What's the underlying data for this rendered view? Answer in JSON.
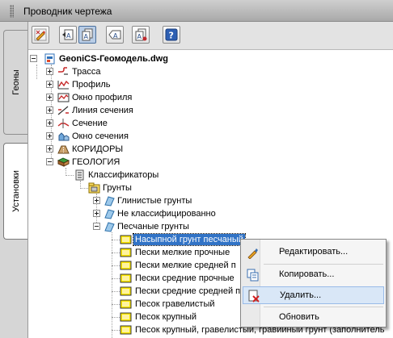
{
  "window": {
    "title": "Проводник чертежа"
  },
  "side_tabs": [
    {
      "label": "Геоны"
    },
    {
      "label": "Установки"
    }
  ],
  "toolbar": {
    "buttons": [
      {
        "icon": "pencil-edit-icon"
      },
      {
        "icon": "doc-a-back-icon"
      },
      {
        "icon": "doc-a-pages-icon",
        "active": true
      },
      {
        "icon": "tag-a-icon"
      },
      {
        "icon": "doc-a-export-icon"
      },
      {
        "icon": "help-icon"
      }
    ]
  },
  "tree": {
    "root": "GeoniCS-Геомодель.dwg",
    "items": {
      "trassa": "Трасса",
      "profil": "Профиль",
      "okno_profilya": "Окно профиля",
      "liniya_secheniya": "Линия сечения",
      "sechenie": "Сечение",
      "okno_secheniya": "Окно сечения",
      "koridory": "КОРИДОРЫ",
      "geologiya": "ГЕОЛОГИЯ",
      "klassifikatory": "Классификаторы",
      "grunty": "Грунты",
      "glinistye": "Глинистые грунты",
      "ne_klass": "Не классифицированно",
      "peschanye": "Песчаные грунты"
    },
    "soils": [
      "Насыпной грунт песчаный",
      "Пески мелкие прочные",
      "Пески мелкие средней п",
      "Пески средние прочные",
      "Пески средние средней п",
      "Песок гравелистый",
      "Песок крупный",
      "Песок крупный, гравелистый, гравийный грунт (заполнитель"
    ]
  },
  "context_menu": {
    "items": [
      {
        "label": "Редактировать...",
        "icon": "edit-icon"
      },
      {
        "label": "Копировать...",
        "icon": "copy-icon"
      },
      {
        "label": "Удалить...",
        "icon": "delete-icon",
        "highlighted": true
      },
      {
        "label": "Обновить",
        "icon": "refresh-icon"
      }
    ]
  },
  "colors": {
    "selection": "#3173c6",
    "menu_highlight": "#d9e7f7",
    "soil_icon": "#ffe800"
  }
}
